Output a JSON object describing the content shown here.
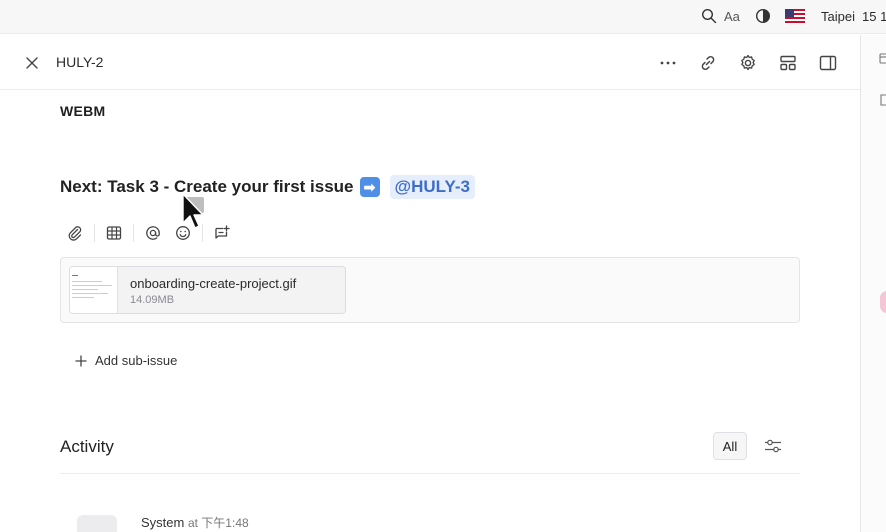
{
  "system_bar": {
    "font_label": "Aa",
    "city": "Taipei",
    "clock": "15 1"
  },
  "header": {
    "issue_id": "HULY-2"
  },
  "content": {
    "heading": "WEBM",
    "next_text": "Next: Task 3 - Create your first issue",
    "next_emoji": "➡",
    "mention": "@HULY-3",
    "attachment": {
      "file_name": "onboarding-create-project.gif",
      "file_size": "14.09MB"
    },
    "add_subissue_label": "Add sub-issue"
  },
  "activity": {
    "title": "Activity",
    "filter_all_label": "All",
    "entry_author": "System",
    "entry_time": "at 下午1:48"
  },
  "colors": {
    "accent": "#3d6ec9",
    "mention_bg": "#e6eefc",
    "emoji_bg": "#4f8fe6"
  }
}
